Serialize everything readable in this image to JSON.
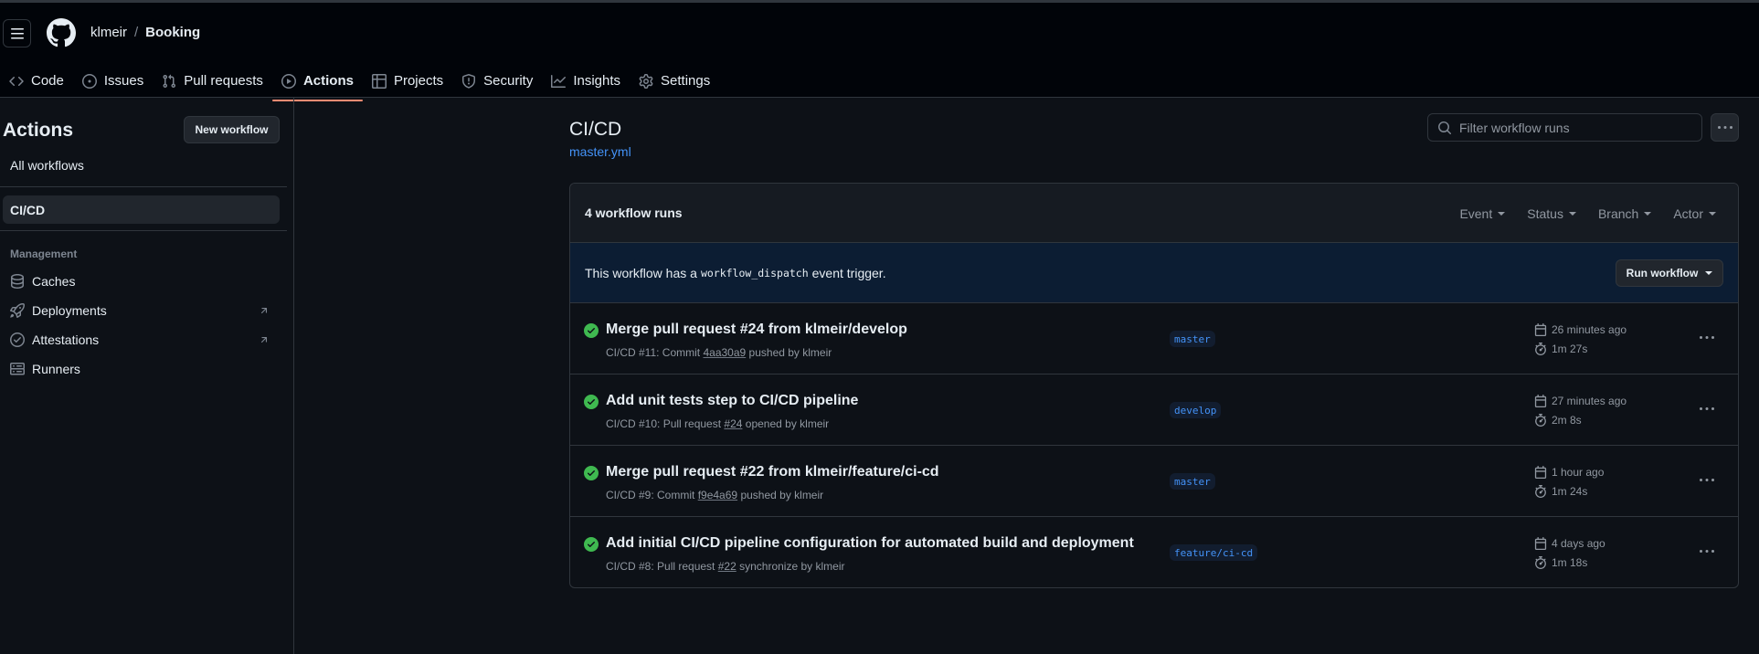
{
  "header": {
    "owner": "klmeir",
    "separator": "/",
    "repo": "Booking"
  },
  "nav": [
    {
      "label": "Code",
      "icon": "code-icon",
      "active": false
    },
    {
      "label": "Issues",
      "icon": "issue-opened-icon",
      "active": false
    },
    {
      "label": "Pull requests",
      "icon": "git-pull-request-icon",
      "active": false
    },
    {
      "label": "Actions",
      "icon": "play-icon",
      "active": true
    },
    {
      "label": "Projects",
      "icon": "table-icon",
      "active": false
    },
    {
      "label": "Security",
      "icon": "shield-icon",
      "active": false
    },
    {
      "label": "Insights",
      "icon": "graph-icon",
      "active": false
    },
    {
      "label": "Settings",
      "icon": "gear-icon",
      "active": false
    }
  ],
  "sidebar": {
    "title": "Actions",
    "new_workflow": "New workflow",
    "all_workflows": "All workflows",
    "workflows": [
      {
        "label": "CI/CD",
        "active": true
      }
    ],
    "management_heading": "Management",
    "management": [
      {
        "label": "Caches",
        "icon": "database-icon"
      },
      {
        "label": "Deployments",
        "icon": "rocket-icon",
        "external": true
      },
      {
        "label": "Attestations",
        "icon": "check-circle-icon",
        "external": true
      },
      {
        "label": "Runners",
        "icon": "server-icon"
      }
    ]
  },
  "main": {
    "title": "CI/CD",
    "file": "master.yml",
    "filter_placeholder": "Filter workflow runs",
    "runs_count": "4 workflow runs",
    "filters": [
      "Event",
      "Status",
      "Branch",
      "Actor"
    ],
    "dispatch": {
      "prefix": "This workflow has a",
      "code": "workflow_dispatch",
      "suffix": "event trigger."
    },
    "run_workflow": "Run workflow",
    "runs": [
      {
        "title": "Merge pull request #24 from klmeir/develop",
        "prefix": "CI/CD #11: Commit",
        "ref": "4aa30a9",
        "suffix": "pushed by klmeir",
        "branch": "master",
        "date": "26 minutes ago",
        "duration": "1m 27s",
        "status": "success"
      },
      {
        "title": "Add unit tests step to CI/CD pipeline",
        "prefix": "CI/CD #10: Pull request",
        "ref": "#24",
        "suffix": "opened by klmeir",
        "branch": "develop",
        "date": "27 minutes ago",
        "duration": "2m 8s",
        "status": "success"
      },
      {
        "title": "Merge pull request #22 from klmeir/feature/ci-cd",
        "prefix": "CI/CD #9: Commit",
        "ref": "f9e4a69",
        "suffix": "pushed by klmeir",
        "branch": "master",
        "date": "1 hour ago",
        "duration": "1m 24s",
        "status": "success"
      },
      {
        "title": "Add initial CI/CD pipeline configuration for automated build and deployment",
        "prefix": "CI/CD #8: Pull request",
        "ref": "#22",
        "suffix": "synchronize by klmeir",
        "branch": "feature/ci-cd",
        "date": "4 days ago",
        "duration": "1m 18s",
        "status": "success"
      }
    ]
  },
  "colors": {
    "background": "#0d1117",
    "header": "#010409",
    "accent": "#4493f8",
    "success": "#3fb950",
    "active_tab": "#fd8c73"
  }
}
